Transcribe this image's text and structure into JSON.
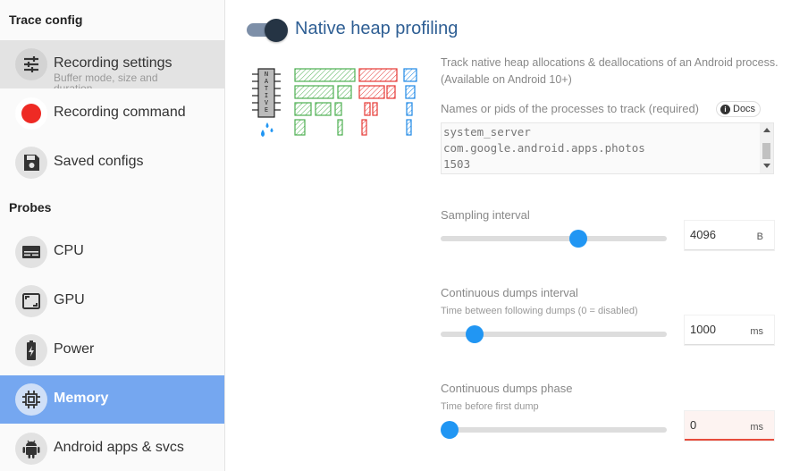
{
  "sidebar": {
    "trace_config_title": "Trace config",
    "probes_title": "Probes",
    "items": [
      {
        "label": "Recording settings",
        "sublabel": "Buffer mode, size and duration",
        "icon": "sliders-icon"
      },
      {
        "label": "Recording command",
        "icon": "record-dot-icon"
      },
      {
        "label": "Saved configs",
        "icon": "save-icon"
      },
      {
        "label": "CPU",
        "icon": "cpu-icon"
      },
      {
        "label": "GPU",
        "icon": "gpu-icon"
      },
      {
        "label": "Power",
        "icon": "battery-icon"
      },
      {
        "label": "Memory",
        "icon": "memory-chip-icon"
      },
      {
        "label": "Android apps & svcs",
        "icon": "android-icon"
      }
    ]
  },
  "probe": {
    "title": "Native heap profiling",
    "enabled": true,
    "description": "Track native heap allocations & deallocations of an Android process. (Available on Android 10+)",
    "illustration_chip_label": "NATIVE",
    "processes": {
      "label": "Names or pids of the processes to track (required)",
      "docs_label": "Docs",
      "lines": [
        "system_server",
        "com.google.android.apps.photos",
        "1503"
      ]
    },
    "sampling": {
      "label": "Sampling interval",
      "value": "4096",
      "unit": "B",
      "fraction": 0.61
    },
    "dumps_interval": {
      "label": "Continuous dumps interval",
      "sublabel": "Time between following dumps (0 = disabled)",
      "value": "1000",
      "unit": "ms",
      "fraction": 0.15
    },
    "dumps_phase": {
      "label": "Continuous dumps phase",
      "sublabel": "Time before first dump",
      "value": "0",
      "unit": "ms",
      "fraction": 0.04
    }
  },
  "colors": {
    "active_nav_bg": "#75a7f0",
    "title_blue": "#2f5f94",
    "slider_blue": "#2196f3",
    "error_red": "#e74c3c"
  }
}
